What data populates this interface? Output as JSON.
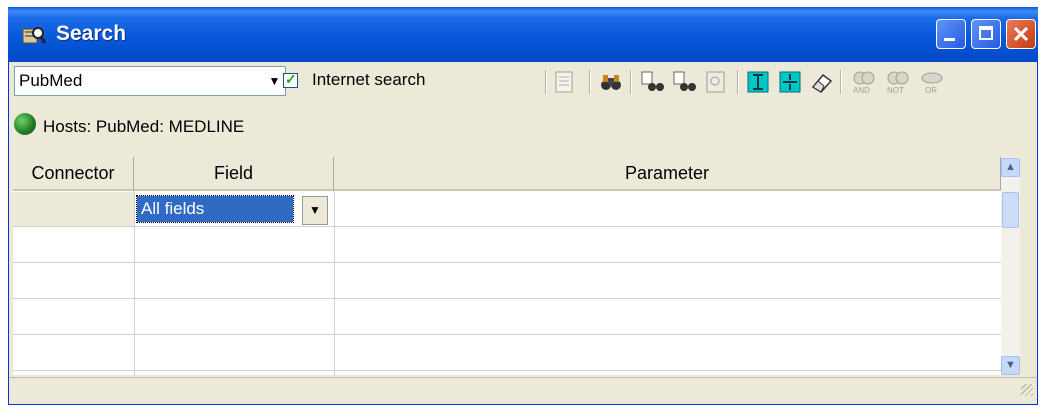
{
  "window": {
    "title": "Search"
  },
  "toolbar": {
    "database": "PubMed",
    "internet_search_label": "Internet search",
    "internet_search_checked": true,
    "icons": [
      "document-icon",
      "binoculars-icon",
      "search-previous-icon",
      "search-next-icon",
      "search-page-icon",
      "insert-row-icon",
      "delete-row-icon",
      "eraser-icon",
      "and-icon",
      "not-icon",
      "or-icon"
    ]
  },
  "hosts": {
    "text": "Hosts: PubMed: MEDLINE"
  },
  "grid": {
    "columns": [
      "Connector",
      "Field",
      "Parameter"
    ],
    "rows": [
      {
        "connector": "",
        "field": "All fields",
        "parameter": ""
      },
      {
        "connector": "",
        "field": "",
        "parameter": ""
      },
      {
        "connector": "",
        "field": "",
        "parameter": ""
      },
      {
        "connector": "",
        "field": "",
        "parameter": ""
      },
      {
        "connector": "",
        "field": "",
        "parameter": ""
      }
    ]
  },
  "logic_buttons": {
    "and": "AND",
    "not": "NOT",
    "or": "OR"
  }
}
